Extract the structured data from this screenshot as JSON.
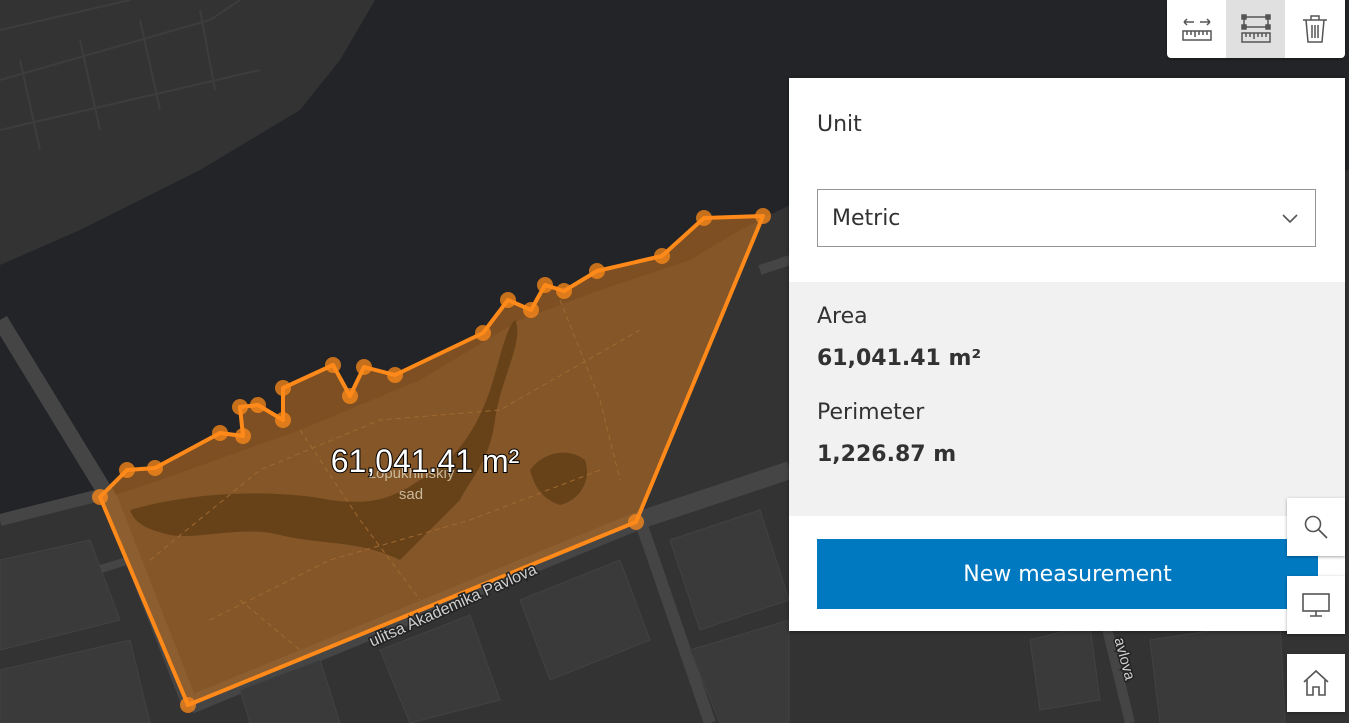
{
  "map": {
    "area_label": "61,041.41 m²",
    "place_name_line1": "Lopukhinskiy",
    "place_name_line2": "sad",
    "street_label": "ulitsa Akademika Pavlova",
    "street_label_partial": "avlova",
    "polygon_fill": "#c8731f",
    "polygon_stroke": "#ff8a1a",
    "water_color": "#222427",
    "land_color": "#333333"
  },
  "toolbar": {
    "distance_icon": "ruler-distance-icon",
    "area_icon": "ruler-area-icon",
    "clear_icon": "trash-icon"
  },
  "panel": {
    "unit_label": "Unit",
    "unit_value": "Metric",
    "area_label": "Area",
    "area_value": "61,041.41 m²",
    "perimeter_label": "Perimeter",
    "perimeter_value": "1,226.87 m",
    "new_button_label": "New measurement",
    "button_color": "#0079c1"
  },
  "side_controls": {
    "search_icon": "search-icon",
    "screen_icon": "monitor-icon",
    "home_icon": "home-icon"
  }
}
